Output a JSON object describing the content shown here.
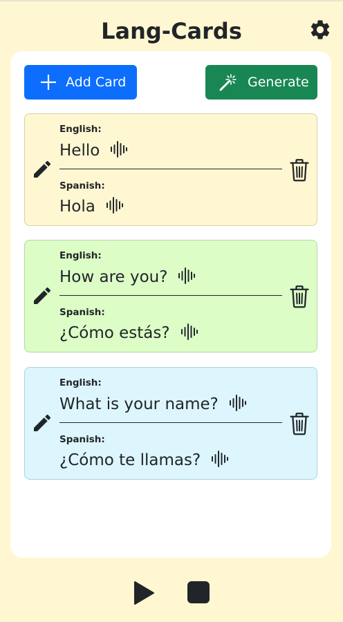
{
  "app": {
    "title": "Lang-Cards",
    "settings_icon": "gear-icon"
  },
  "toolbar": {
    "add_label": "Add Card",
    "add_icon": "plus-icon",
    "add_color": "#0d6efd",
    "generate_label": "Generate",
    "generate_icon": "magic-wand-icon",
    "generate_color": "#198754"
  },
  "cards": [
    {
      "source_language": "English:",
      "source_text": "Hello",
      "target_language": "Spanish:",
      "target_text": "Hola",
      "background": "#fff7d1",
      "border": "#d9cfa6"
    },
    {
      "source_language": "English:",
      "source_text": "How are you?",
      "target_language": "Spanish:",
      "target_text": "¿Cómo estás?",
      "background": "#dcfdc6",
      "border": "#b6d6a3"
    },
    {
      "source_language": "English:",
      "source_text": "What is your name?",
      "target_language": "Spanish:",
      "target_text": "¿Cómo te llamas?",
      "background": "#ddf6fd",
      "border": "#aed1dc"
    }
  ],
  "card_icons": {
    "edit": "pencil-icon",
    "delete": "trash-icon",
    "audio": "audio-wave-icon"
  },
  "player": {
    "play_icon": "play-icon",
    "stop_icon": "stop-icon"
  },
  "colors": {
    "page_background": "#fff7d1",
    "panel_background": "#ffffff",
    "text": "#212529"
  }
}
